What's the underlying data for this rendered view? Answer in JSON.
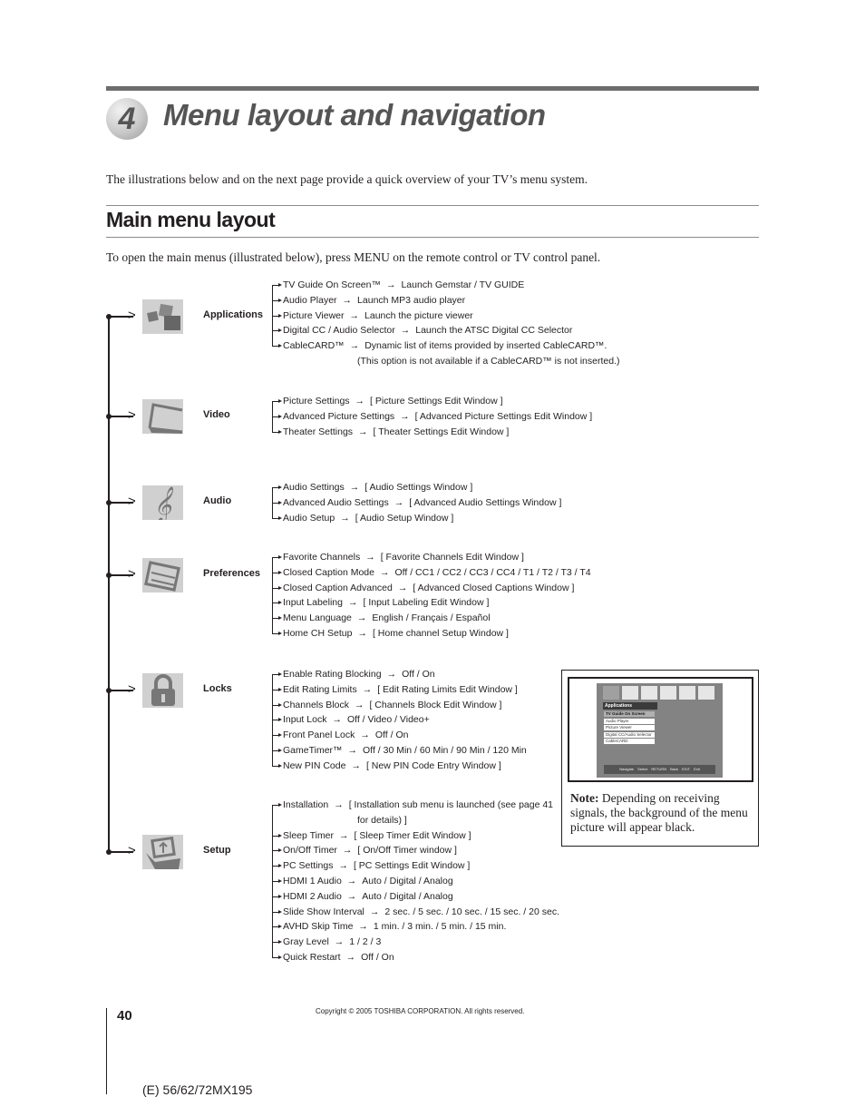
{
  "header": {
    "chapter_number": "4",
    "chapter_title": "Menu layout and navigation"
  },
  "intro": "The illustrations below and on the next page provide a quick overview of your TV’s menu system.",
  "section": {
    "title": "Main menu layout",
    "instruction": "To open the main menus (illustrated below), press MENU on the remote control or TV control panel."
  },
  "menus": [
    {
      "label": "Applications",
      "icon": "applications-icon",
      "items": [
        {
          "name": "TV Guide On Screen™",
          "value": "Launch Gemstar / TV GUIDE"
        },
        {
          "name": "Audio Player",
          "value": "Launch MP3 audio player"
        },
        {
          "name": "Picture Viewer",
          "value": "Launch the picture viewer"
        },
        {
          "name": "Digital CC / Audio Selector",
          "value": "Launch the ATSC Digital CC Selector"
        },
        {
          "name": "CableCARD™",
          "value": "Dynamic list of items provided by inserted CableCARD™.",
          "cont": "(This option is not available if a CableCARD™ is not inserted.)"
        }
      ]
    },
    {
      "label": "Video",
      "icon": "video-icon",
      "items": [
        {
          "name": "Picture Settings",
          "value": "[ Picture Settings Edit Window ]"
        },
        {
          "name": "Advanced Picture Settings",
          "value": "[ Advanced Picture Settings Edit Window ]"
        },
        {
          "name": "Theater Settings",
          "value": "[ Theater Settings Edit Window ]"
        }
      ]
    },
    {
      "label": "Audio",
      "icon": "audio-icon",
      "items": [
        {
          "name": "Audio Settings",
          "value": "[ Audio Settings Window ]"
        },
        {
          "name": "Advanced Audio Settings",
          "value": "[ Advanced Audio Settings Window ]"
        },
        {
          "name": "Audio Setup",
          "value": "[ Audio Setup Window ]"
        }
      ]
    },
    {
      "label": "Preferences",
      "icon": "preferences-icon",
      "items": [
        {
          "name": "Favorite Channels",
          "value": "[ Favorite Channels Edit Window ]"
        },
        {
          "name": "Closed Caption Mode",
          "value": "Off / CC1 / CC2 / CC3 / CC4 / T1 / T2 / T3 / T4"
        },
        {
          "name": "Closed Caption Advanced",
          "value": "[ Advanced Closed Captions Window ]"
        },
        {
          "name": "Input Labeling",
          "value": "[ Input Labeling Edit Window ]"
        },
        {
          "name": "Menu Language",
          "value": "English / Français / Español"
        },
        {
          "name": "Home CH Setup",
          "value": "[ Home channel Setup Window ]"
        }
      ]
    },
    {
      "label": "Locks",
      "icon": "lock-icon",
      "items": [
        {
          "name": "Enable Rating Blocking",
          "value": "Off / On"
        },
        {
          "name": "Edit Rating Limits",
          "value": "[ Edit Rating Limits Edit Window ]"
        },
        {
          "name": "Channels Block",
          "value": "[ Channels Block Edit Window ]"
        },
        {
          "name": "Input Lock",
          "value": "Off / Video / Video+"
        },
        {
          "name": "Front Panel Lock",
          "value": "Off / On"
        },
        {
          "name": "GameTimer™",
          "value": "Off / 30 Min / 60 Min / 90 Min / 120 Min"
        },
        {
          "name": "New PIN Code",
          "value": "[ New PIN Code Entry Window ]"
        }
      ]
    },
    {
      "label": "Setup",
      "icon": "setup-icon",
      "items": [
        {
          "name": "Installation",
          "value": "[ Installation sub menu is launched (see page 41",
          "cont": "for details) ]"
        },
        {
          "name": "Sleep Timer",
          "value": "[ Sleep Timer Edit Window ]"
        },
        {
          "name": "On/Off Timer",
          "value": "[ On/Off Timer window ]"
        },
        {
          "name": "PC Settings",
          "value": "[ PC Settings Edit Window ]"
        },
        {
          "name": "HDMI 1 Audio",
          "value": "Auto / Digital / Analog"
        },
        {
          "name": "HDMI 2 Audio",
          "value": "Auto / Digital / Analog"
        },
        {
          "name": "Slide Show Interval",
          "value": "2 sec. / 5 sec. / 10 sec. / 15 sec. / 20 sec."
        },
        {
          "name": "AVHD Skip Time",
          "value": "1 min. / 3 min. / 5 min. / 15 min."
        },
        {
          "name": "Gray Level",
          "value": "1 / 2 / 3"
        },
        {
          "name": "Quick Restart",
          "value": "Off / On"
        }
      ]
    }
  ],
  "arrow_glyph": "→",
  "screen_preview": {
    "menu_title": "Applications",
    "items": [
      "TV Guide On Screen",
      "Audio Player",
      "Picture Viewer",
      "Digital CC/Audio Selector",
      "CableCARD"
    ],
    "selected_index": 0,
    "footer": "Navigate  Select  RETURN Back  EXIT Exit"
  },
  "note": {
    "label": "Note:",
    "text": " Depending on receiving signals, the background of the menu picture will appear black."
  },
  "footer": {
    "page_number": "40",
    "copyright": "Copyright © 2005 TOSHIBA CORPORATION. All rights reserved.",
    "model": "(E) 56/62/72MX195"
  }
}
